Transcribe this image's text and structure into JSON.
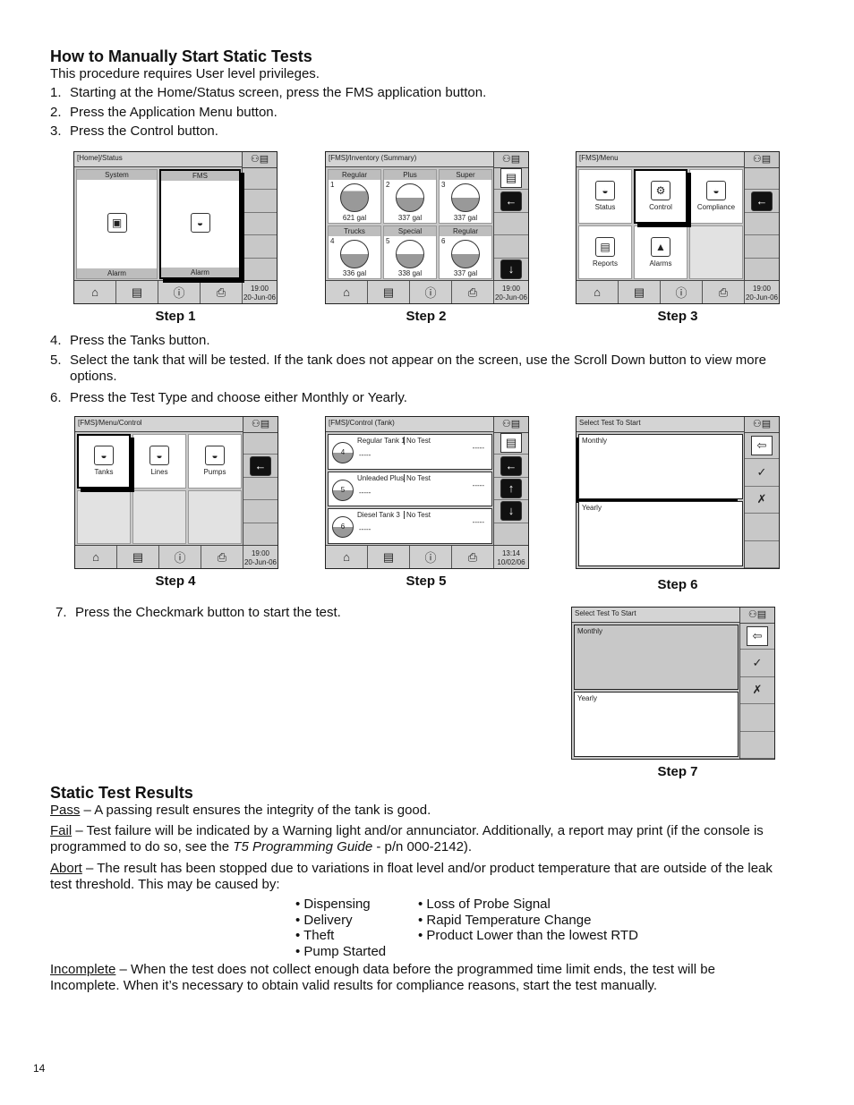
{
  "heading1": "How to Manually Start Static Tests",
  "intro": "This procedure requires User level privileges.",
  "steps_a": [
    {
      "n": "1.",
      "text": "Starting at the Home/Status screen, press the FMS application button."
    },
    {
      "n": "2.",
      "text": "Press the Application Menu button."
    },
    {
      "n": "3.",
      "text": "Press the Control button."
    }
  ],
  "steps_b": [
    {
      "n": "4.",
      "text": "Press the Tanks button."
    },
    {
      "n": "5.",
      "text": "Select the tank that will be tested. If the tank does not appear on the screen, use the Scroll Down button to view more options."
    },
    {
      "n": "6.",
      "text": "Press the Test Type and choose either Monthly or Yearly."
    }
  ],
  "step7": {
    "n": "7.",
    "text": "Press the Checkmark button to start the test."
  },
  "captions": [
    "Step 1",
    "Step 2",
    "Step 3",
    "Step 4",
    "Step 5",
    "Step 6",
    "Step 7"
  ],
  "screens": [
    {
      "title": "[Home]/Status",
      "time": "19:00",
      "date": "20-Jun-06",
      "cols": 2,
      "rows": 1,
      "side": [
        "",
        "",
        "",
        "",
        ""
      ],
      "cells": [
        {
          "kind": "hdr",
          "h": "System",
          "f": "Alarm",
          "icon": "monitor-icon",
          "glyph": "▣"
        },
        {
          "kind": "hdr",
          "h": "FMS",
          "f": "Alarm",
          "icon": "tank-icon",
          "glyph": "◒",
          "sel": true
        }
      ]
    },
    {
      "title": "[FMS]/Inventory (Summary)",
      "time": "19:00",
      "date": "20-Jun-06",
      "cols": 3,
      "rows": 2,
      "side": [
        "menu-icon",
        "back-arrow-icon",
        "",
        "",
        "scroll-down-icon"
      ],
      "cells": [
        {
          "kind": "tank",
          "h": "Regular",
          "n": "1",
          "v": "621 gal",
          "hi": true
        },
        {
          "kind": "tank",
          "h": "Plus",
          "n": "2",
          "v": "337 gal"
        },
        {
          "kind": "tank",
          "h": "Super",
          "n": "3",
          "v": "337 gal"
        },
        {
          "kind": "tank",
          "h": "Trucks",
          "n": "4",
          "v": "336 gal"
        },
        {
          "kind": "tank",
          "h": "Special",
          "n": "5",
          "v": "338 gal"
        },
        {
          "kind": "tank",
          "h": "Regular",
          "n": "6",
          "v": "337 gal"
        }
      ]
    },
    {
      "title": "[FMS]/Menu",
      "time": "19:00",
      "date": "20-Jun-06",
      "cols": 3,
      "rows": 2,
      "side": [
        "",
        "back-arrow-icon",
        "",
        "",
        ""
      ],
      "cells": [
        {
          "kind": "btn",
          "l": "Status",
          "icon": "tank-icon",
          "glyph": "◒"
        },
        {
          "kind": "btn",
          "l": "Control",
          "icon": "control-icon",
          "glyph": "⚙",
          "sel": true
        },
        {
          "kind": "btn",
          "l": "Compliance",
          "icon": "compliance-icon",
          "glyph": "◒"
        },
        {
          "kind": "btn",
          "l": "Reports",
          "icon": "reports-icon",
          "glyph": "▤"
        },
        {
          "kind": "btn",
          "l": "Alarms",
          "icon": "alarm-icon",
          "glyph": "▲"
        },
        {
          "kind": "empty"
        }
      ]
    },
    {
      "title": "[FMS]/Menu/Control",
      "time": "19:00",
      "date": "20-Jun-06",
      "cols": 3,
      "rows": 2,
      "side": [
        "",
        "back-arrow-icon",
        "",
        "",
        ""
      ],
      "cells": [
        {
          "kind": "btn",
          "l": "Tanks",
          "icon": "tank-icon",
          "glyph": "◒",
          "sel": true
        },
        {
          "kind": "btn",
          "l": "Lines",
          "icon": "lines-icon",
          "glyph": "◒"
        },
        {
          "kind": "btn",
          "l": "Pumps",
          "icon": "pumps-icon",
          "glyph": "◒"
        },
        {
          "kind": "empty"
        },
        {
          "kind": "empty"
        },
        {
          "kind": "empty"
        }
      ]
    },
    {
      "title": "[FMS]/Control (Tank)",
      "time": "13:14",
      "date": "10/02/06",
      "cols": 1,
      "rows": 3,
      "side": [
        "menu-icon",
        "back-arrow-icon",
        "scroll-up-icon",
        "scroll-down-icon",
        ""
      ],
      "cells": [
        {
          "kind": "row",
          "n": "4",
          "name": "Regular Tank 1",
          "status": "No Test",
          "d1": "-----",
          "d2": "-----"
        },
        {
          "kind": "row",
          "n": "5",
          "name": "Unleaded Plus",
          "status": "No Test",
          "d1": "-----",
          "d2": "-----"
        },
        {
          "kind": "row",
          "n": "6",
          "name": "Diesel Tank 3",
          "status": "No Test",
          "d1": "-----",
          "d2": "-----"
        }
      ]
    },
    {
      "title": "Select Test To Start",
      "nobottom": true,
      "cols": 1,
      "rows": 2,
      "side": [
        "exit-icon",
        "checkmark-icon",
        "cancel-icon",
        "",
        ""
      ],
      "cells": [
        {
          "kind": "opt",
          "l": "Monthly",
          "sel": true
        },
        {
          "kind": "opt",
          "l": "Yearly"
        }
      ]
    },
    {
      "title": "Select Test To Start",
      "nobottom": true,
      "cols": 1,
      "rows": 2,
      "side": [
        "exit-icon",
        "checkmark-icon",
        "cancel-icon",
        "",
        ""
      ],
      "cells": [
        {
          "kind": "opt",
          "l": "Monthly",
          "grey": true
        },
        {
          "kind": "opt",
          "l": "Yearly"
        }
      ]
    }
  ],
  "heading2": "Static Test Results",
  "pass": {
    "term": "Pass",
    "text": " – A passing result ensures the integrity of the tank is good."
  },
  "fail": {
    "term": "Fail",
    "text1": " – Test failure will be indicated by a Warning light and/or annunciator. Additionally, a report may print (if the console is",
    "text2": "programmed to do so, see the ",
    "guide": "T5 Programming Guide",
    "text3": " - p/n 000-2142)."
  },
  "abort": {
    "term": "Abort",
    "text1": " – The result has been stopped due to variations in float level and/or product temperature that are outside of the leak",
    "text2": "test threshold. This may be caused by:"
  },
  "causes_left": [
    "Dispensing",
    "Delivery",
    "Theft",
    "Pump Started"
  ],
  "causes_right": [
    "Loss of Probe Signal",
    "Rapid Temperature Change",
    "Product Lower than the lowest RTD"
  ],
  "incomplete": {
    "term": "Incomplete",
    "text1": " – When the test does not collect enough data before the programmed time limit ends, the test will be",
    "text2": "Incomplete. When it’s necessary to obtain valid results for compliance reasons, start the test manually."
  },
  "page_number": "14"
}
